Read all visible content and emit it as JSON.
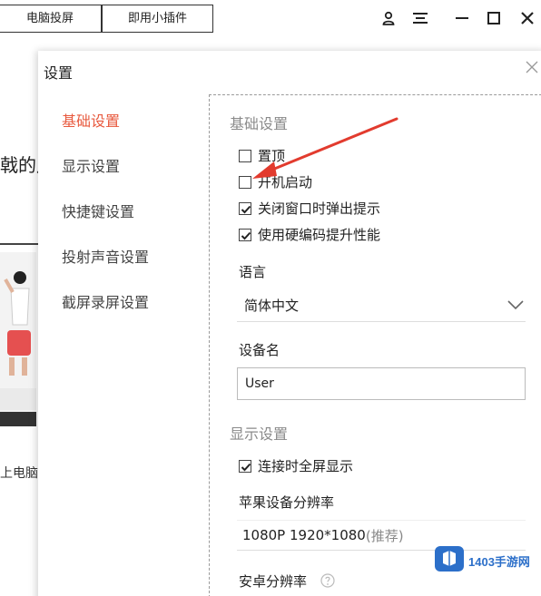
{
  "top_tabs": [
    "电脑投屏",
    "即用小插件"
  ],
  "window_controls": [
    "user-icon",
    "menu-icon",
    "minimize-icon",
    "maximize-icon",
    "close-icon"
  ],
  "background": {
    "partial_heading": "戟的月",
    "bottom_text": "上电脑"
  },
  "dialog": {
    "title": "设置",
    "nav": [
      {
        "label": "基础设置",
        "active": true
      },
      {
        "label": "显示设置",
        "active": false
      },
      {
        "label": "快捷键设置",
        "active": false
      },
      {
        "label": "投射声音设置",
        "active": false
      },
      {
        "label": "截屏录屏设置",
        "active": false
      }
    ],
    "basic": {
      "section_title": "基础设置",
      "options": [
        {
          "label": "置顶",
          "checked": false
        },
        {
          "label": "开机启动",
          "checked": false
        },
        {
          "label": "关闭窗口时弹出提示",
          "checked": true
        },
        {
          "label": "使用硬编码提升性能",
          "checked": true
        }
      ],
      "language_label": "语言",
      "language_value": "简体中文",
      "device_name_label": "设备名",
      "device_name_value": "User"
    },
    "display": {
      "section_title": "显示设置",
      "fullscreen_label": "连接时全屏显示",
      "fullscreen_checked": true,
      "apple_res_label": "苹果设备分辨率",
      "apple_res_value": "1080P 1920*1080",
      "apple_res_hint": "(推荐)",
      "android_res_label": "安卓分辨率"
    }
  },
  "watermark": {
    "text": "1403手游网"
  },
  "colors": {
    "active_nav": "#e8593e",
    "annotation_arrow": "#e23b2e",
    "section_title": "#8a8a8a"
  }
}
